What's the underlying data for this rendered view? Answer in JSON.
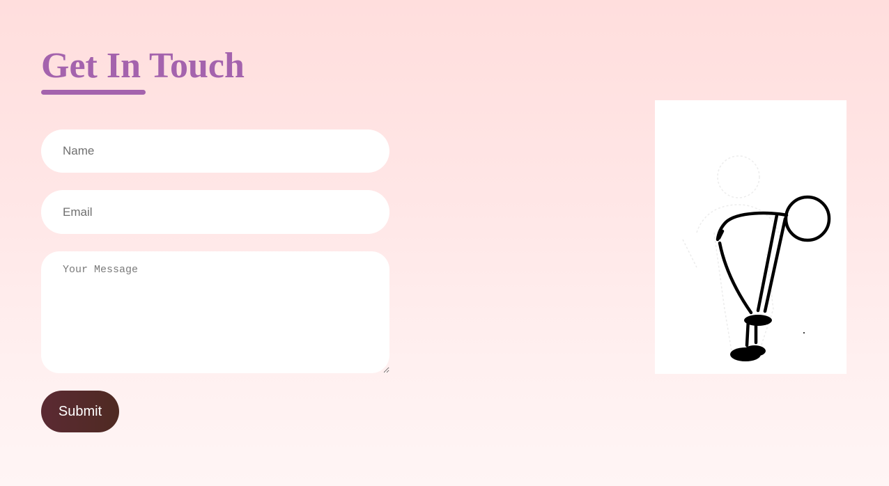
{
  "contact": {
    "title": "Get In Touch",
    "name_placeholder": "Name",
    "email_placeholder": "Email",
    "message_placeholder": "Your Message",
    "submit_label": "Submit"
  },
  "colors": {
    "accent": "#a463ad",
    "button": "#552a2c",
    "field_background": "#ffffff"
  },
  "illustration": {
    "icon": "bowing-stick-figure-icon"
  }
}
